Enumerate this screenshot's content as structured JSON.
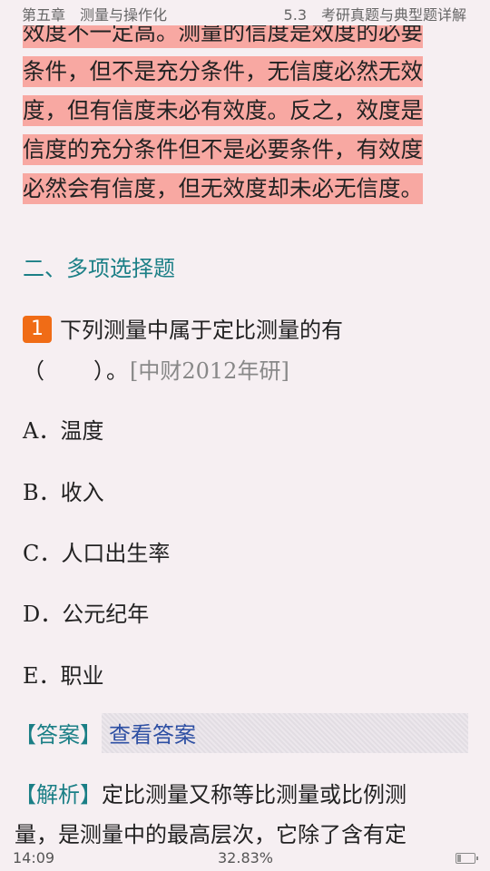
{
  "header": {
    "chapter": "第五章　测量与操作化",
    "section": "5.3　考研真题与典型题详解"
  },
  "highlight_lines": [
    "效度不一定高。测量的信度是效度的必要",
    "条件，但不是充分条件，无信度必然无效",
    "度，但有信度未必有效度。反之，效度是",
    "信度的充分条件但不是必要条件，有效度",
    "必然会有信度，但无效度却未必无信度。"
  ],
  "section_heading": "二、多项选择题",
  "question": {
    "number": "1",
    "text_line1": "下列测量中属于定比测量的有",
    "paren": "（　　）。",
    "source": "[中财2012年研]"
  },
  "options": [
    {
      "letter": "A．",
      "text": "温度"
    },
    {
      "letter": "B．",
      "text": "收入"
    },
    {
      "letter": "C．",
      "text": "人口出生率"
    },
    {
      "letter": "D．",
      "text": "公元纪年"
    },
    {
      "letter": "E．",
      "text": "职业"
    }
  ],
  "answer": {
    "label": "【答案】",
    "link_text": "查看答案"
  },
  "analysis": {
    "label": "【解析】",
    "line1": "定比测量又称等比测量或比例测",
    "line2": "量，是测量中的最高层次，它除了含有定"
  },
  "footer": {
    "time": "14:09",
    "progress_text": "32.83%",
    "battery_level": 0.2
  }
}
